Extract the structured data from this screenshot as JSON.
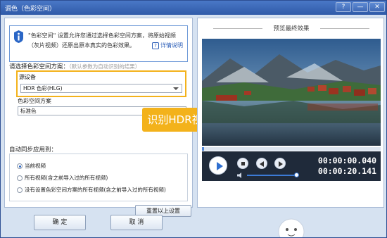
{
  "window": {
    "title": "调色（色彩空间）",
    "help_btn": "?",
    "min_btn": "—",
    "close_btn": "✕"
  },
  "info": {
    "text": "\"色彩空间\" 设置允许您通过选择色彩空间方案，将原始视频（灰片视频）还原出原本真实的色彩效果。",
    "help_link": "详情说明",
    "help_icon_char": "?",
    "icon": "info-icon"
  },
  "color_space": {
    "section_title": "请选择色彩空间方案：",
    "hint": "（默认参数为自动识别的结果）",
    "source_label": "源设备",
    "source_value": "HDR 色彩(HLG)",
    "scheme_label": "色彩空间方案",
    "scheme_value": "标准色"
  },
  "badge": {
    "text": "识别HDR视频"
  },
  "auto_apply": {
    "title": "自动同步应用到：",
    "options": [
      {
        "label": "当前视频",
        "selected": true
      },
      {
        "label": "所有视频(含之前导入过的所有视频)",
        "selected": false
      },
      {
        "label": "没有设置色彩空间方案的所有视频(含之前导入过的所有视频)",
        "selected": false
      }
    ]
  },
  "buttons": {
    "reset": "重置以上设置",
    "ok": "确 定",
    "cancel": "取 消"
  },
  "preview": {
    "title": "预览最终效果",
    "progress": 0.01,
    "time_current": "00:00:00.040",
    "time_total": "00:00:20.141",
    "volume": 0.9
  },
  "colors": {
    "accent": "#f3b21b",
    "titlebar": "#3562b3",
    "link": "#2d5fb8"
  }
}
